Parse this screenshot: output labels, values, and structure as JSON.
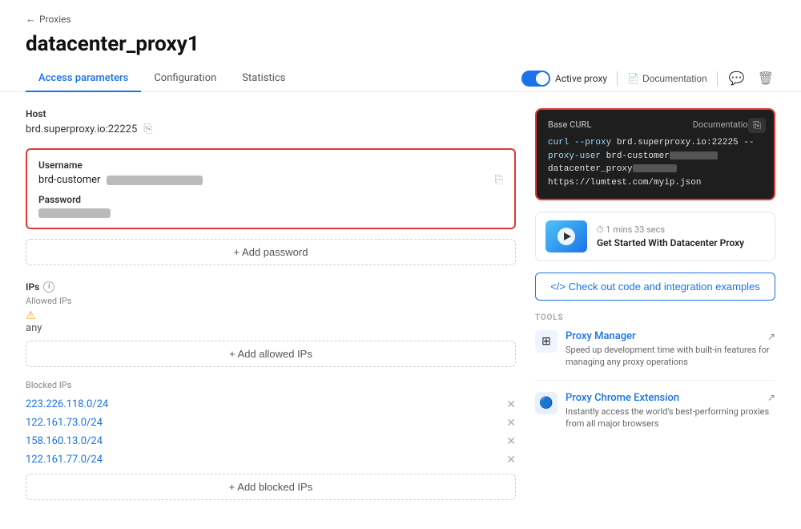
{
  "back": {
    "label": "Proxies",
    "arrow": "←"
  },
  "page_title": "datacenter_proxy1",
  "tabs": [
    {
      "label": "Access parameters",
      "active": true
    },
    {
      "label": "Configuration",
      "active": false
    },
    {
      "label": "Statistics",
      "active": false
    }
  ],
  "toolbar": {
    "toggle_label": "Active proxy",
    "doc_label": "Documentation",
    "doc_icon": "📄"
  },
  "left": {
    "host_label": "Host",
    "host_value": "brd.superproxy.io:22225",
    "username_label": "Username",
    "username_prefix": "brd-customer",
    "password_label": "Password",
    "add_password_label": "+ Add password",
    "ips_label": "IPs",
    "allowed_ips_label": "Allowed IPs",
    "any_label": "any",
    "add_allowed_label": "+ Add allowed IPs",
    "blocked_ips_label": "Blocked IPs",
    "blocked_ips": [
      "223.226.118.0/24",
      "122.161.73.0/24",
      "158.160.13.0/24",
      "122.161.77.0/24"
    ],
    "add_blocked_label": "+ Add blocked IPs"
  },
  "right": {
    "curl_title": "Base CURL",
    "curl_doc_label": "Documentation",
    "curl_code_line1": "curl --proxy brd.superproxy.io:22225 --",
    "curl_code_line2": "proxy-user brd-customer",
    "curl_code_line3": "datacenter_proxy",
    "curl_code_line4": "https://lumtest.com/myip.json",
    "video_duration": "⏱ 1 mins 33 secs",
    "video_title": "Get Started With Datacenter Proxy",
    "code_examples_label": "</> Check out code and integration examples",
    "tools_label": "TOOLS",
    "tools": [
      {
        "title": "Proxy Manager",
        "desc": "Speed up development time with built-in features for managing any proxy operations",
        "icon": "⊞",
        "arrow": "↗"
      },
      {
        "title": "Proxy Chrome Extension",
        "desc": "Instantly access the world's best-performing proxies from all major browsers",
        "icon": "🔵",
        "arrow": "↗"
      }
    ]
  }
}
